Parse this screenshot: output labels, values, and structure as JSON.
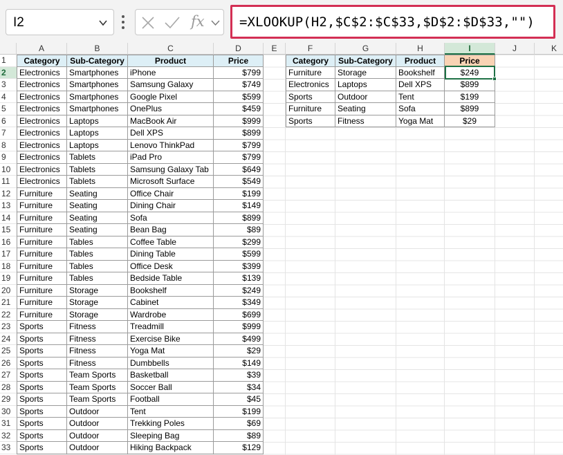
{
  "formula_bar": {
    "name_box": "I2",
    "formula": "=XLOOKUP(H2,$C$2:$C$33,$D$2:$D$33,\"\")"
  },
  "columns": [
    "A",
    "B",
    "C",
    "D",
    "E",
    "F",
    "G",
    "H",
    "I",
    "J",
    "K"
  ],
  "rows": [
    "1",
    "2",
    "3",
    "4",
    "5",
    "6",
    "7",
    "8",
    "9",
    "10",
    "11",
    "12",
    "13",
    "14",
    "15",
    "16",
    "17",
    "18",
    "19",
    "20",
    "21",
    "22",
    "23",
    "24",
    "25",
    "26",
    "27",
    "28",
    "29",
    "30",
    "31",
    "32",
    "33"
  ],
  "table1": {
    "headers": [
      "Category",
      "Sub-Category",
      "Product",
      "Price"
    ],
    "rows": [
      [
        "Electronics",
        "Smartphones",
        "iPhone",
        "$799"
      ],
      [
        "Electronics",
        "Smartphones",
        "Samsung Galaxy",
        "$749"
      ],
      [
        "Electronics",
        "Smartphones",
        "Google Pixel",
        "$599"
      ],
      [
        "Electronics",
        "Smartphones",
        "OnePlus",
        "$459"
      ],
      [
        "Electronics",
        "Laptops",
        "MacBook Air",
        "$999"
      ],
      [
        "Electronics",
        "Laptops",
        "Dell XPS",
        "$899"
      ],
      [
        "Electronics",
        "Laptops",
        "Lenovo ThinkPad",
        "$799"
      ],
      [
        "Electronics",
        "Tablets",
        "iPad Pro",
        "$799"
      ],
      [
        "Electronics",
        "Tablets",
        "Samsung Galaxy Tab",
        "$649"
      ],
      [
        "Electronics",
        "Tablets",
        "Microsoft Surface",
        "$549"
      ],
      [
        "Furniture",
        "Seating",
        "Office Chair",
        "$199"
      ],
      [
        "Furniture",
        "Seating",
        "Dining Chair",
        "$149"
      ],
      [
        "Furniture",
        "Seating",
        "Sofa",
        "$899"
      ],
      [
        "Furniture",
        "Seating",
        "Bean Bag",
        "$89"
      ],
      [
        "Furniture",
        "Tables",
        "Coffee Table",
        "$299"
      ],
      [
        "Furniture",
        "Tables",
        "Dining Table",
        "$599"
      ],
      [
        "Furniture",
        "Tables",
        "Office Desk",
        "$399"
      ],
      [
        "Furniture",
        "Tables",
        "Bedside Table",
        "$139"
      ],
      [
        "Furniture",
        "Storage",
        "Bookshelf",
        "$249"
      ],
      [
        "Furniture",
        "Storage",
        "Cabinet",
        "$349"
      ],
      [
        "Furniture",
        "Storage",
        "Wardrobe",
        "$699"
      ],
      [
        "Sports",
        "Fitness",
        "Treadmill",
        "$999"
      ],
      [
        "Sports",
        "Fitness",
        "Exercise Bike",
        "$499"
      ],
      [
        "Sports",
        "Fitness",
        "Yoga Mat",
        "$29"
      ],
      [
        "Sports",
        "Fitness",
        "Dumbbells",
        "$149"
      ],
      [
        "Sports",
        "Team Sports",
        "Basketball",
        "$39"
      ],
      [
        "Sports",
        "Team Sports",
        "Soccer Ball",
        "$34"
      ],
      [
        "Sports",
        "Team Sports",
        "Football",
        "$45"
      ],
      [
        "Sports",
        "Outdoor",
        "Tent",
        "$199"
      ],
      [
        "Sports",
        "Outdoor",
        "Trekking Poles",
        "$69"
      ],
      [
        "Sports",
        "Outdoor",
        "Sleeping Bag",
        "$89"
      ],
      [
        "Sports",
        "Outdoor",
        "Hiking Backpack",
        "$129"
      ]
    ]
  },
  "table2": {
    "headers": [
      "Category",
      "Sub-Category",
      "Product",
      "Price"
    ],
    "rows": [
      [
        "Furniture",
        "Storage",
        "Bookshelf",
        "$249"
      ],
      [
        "Electronics",
        "Laptops",
        "Dell XPS",
        "$899"
      ],
      [
        "Sports",
        "Outdoor",
        "Tent",
        "$199"
      ],
      [
        "Furniture",
        "Seating",
        "Sofa",
        "$899"
      ],
      [
        "Sports",
        "Fitness",
        "Yoga Mat",
        "$29"
      ]
    ]
  },
  "selection": {
    "cell": "I2",
    "column": "I",
    "row": "2"
  },
  "colors": {
    "formula_border": "#d32f54",
    "selection": "#1e7145",
    "header_fill": "#ddeff6",
    "price_header_fill": "#f9d3b4"
  }
}
